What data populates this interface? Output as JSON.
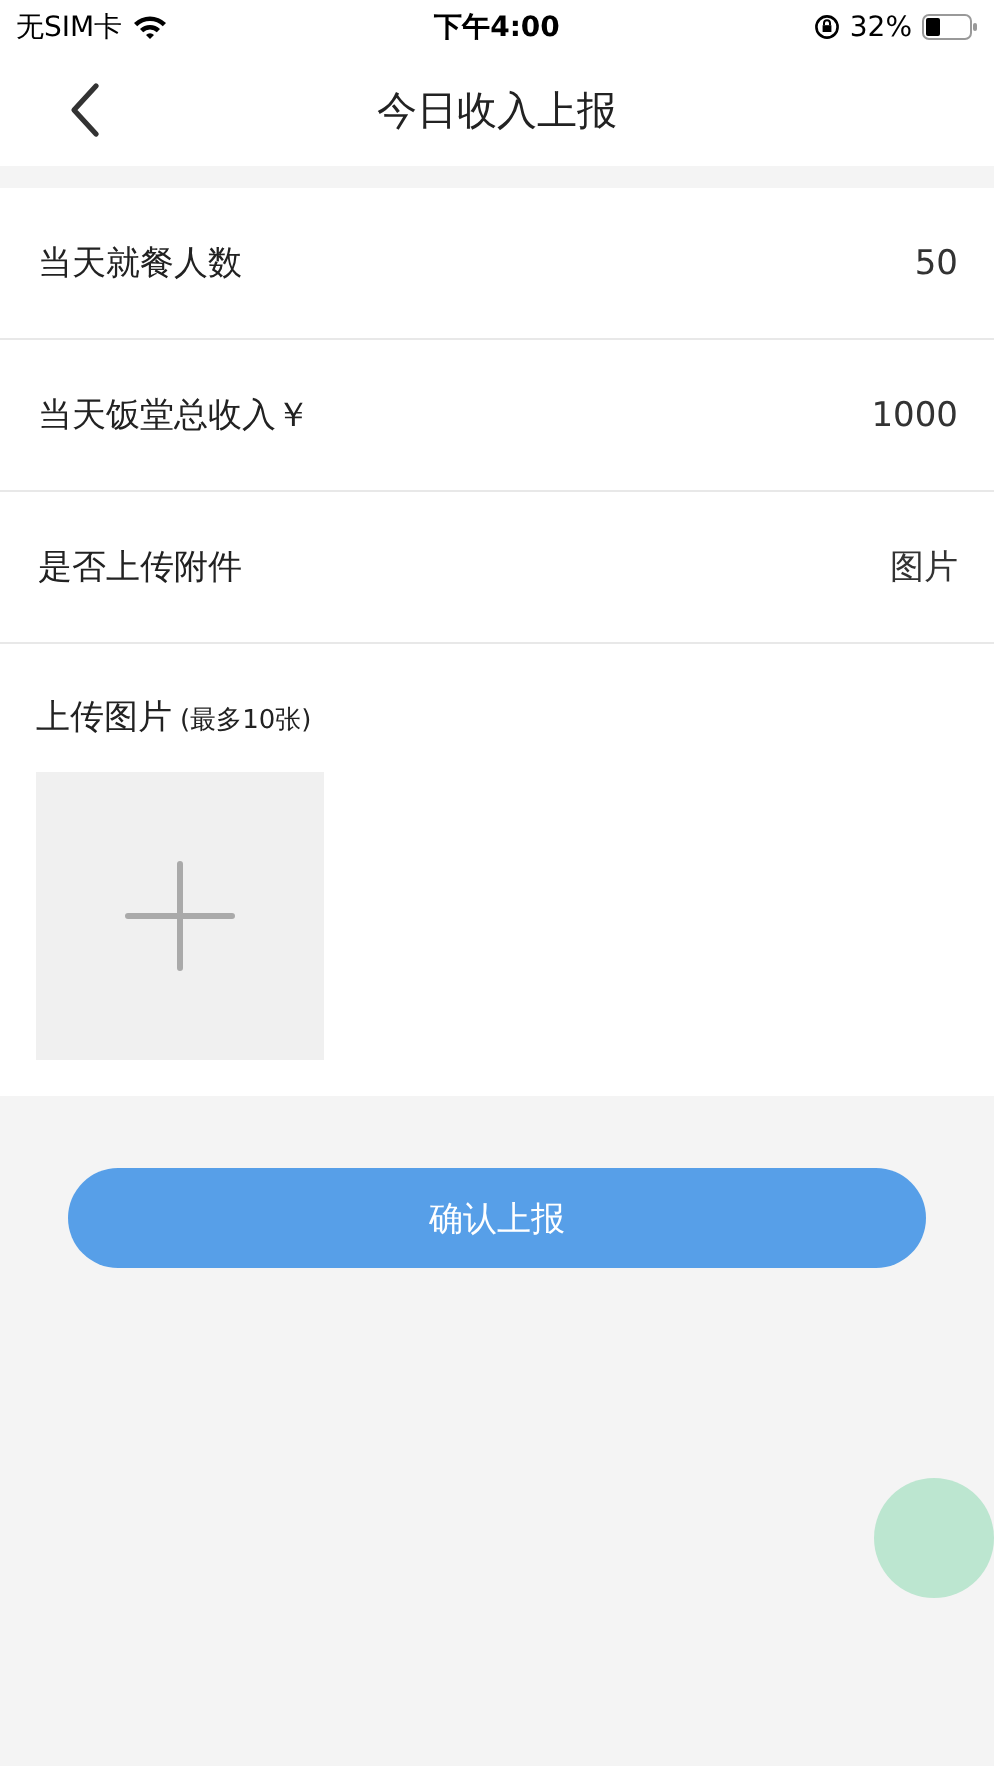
{
  "status_bar": {
    "carrier": "无SIM卡",
    "time": "下午4:00",
    "battery": "32%"
  },
  "nav": {
    "title": "今日收入上报"
  },
  "rows": [
    {
      "label": "当天就餐人数",
      "value": "50"
    },
    {
      "label": "当天饭堂总收入￥",
      "value": "1000"
    },
    {
      "label": "是否上传附件",
      "value": "图片"
    }
  ],
  "upload": {
    "label": "上传图片",
    "note": "(最多10张)"
  },
  "submit": {
    "label": "确认上报"
  }
}
